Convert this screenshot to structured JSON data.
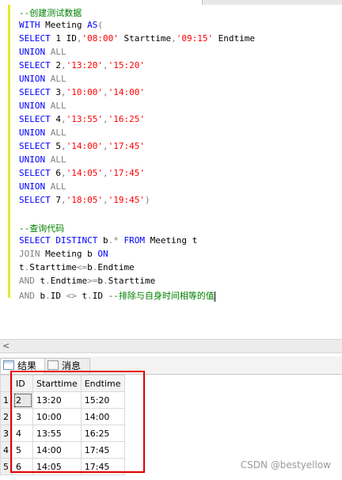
{
  "code_lines": [
    [
      {
        "t": "--创建测试数据",
        "c": "cmt"
      }
    ],
    [
      {
        "t": "WITH ",
        "c": "kw"
      },
      {
        "t": "Meeting ",
        "c": "plain"
      },
      {
        "t": "AS",
        "c": "kw"
      },
      {
        "t": "(",
        "c": "gray"
      }
    ],
    [
      {
        "t": "SELECT ",
        "c": "kw"
      },
      {
        "t": "1 ",
        "c": "plain"
      },
      {
        "t": "ID",
        "c": "plain"
      },
      {
        "t": ",",
        "c": "gray"
      },
      {
        "t": "'08:00'",
        "c": "str"
      },
      {
        "t": " Starttime",
        "c": "plain"
      },
      {
        "t": ",",
        "c": "gray"
      },
      {
        "t": "'09:15'",
        "c": "str"
      },
      {
        "t": " Endtime",
        "c": "plain"
      }
    ],
    [
      {
        "t": "UNION ",
        "c": "kw"
      },
      {
        "t": "ALL",
        "c": "gray"
      }
    ],
    [
      {
        "t": "SELECT ",
        "c": "kw"
      },
      {
        "t": "2",
        "c": "plain"
      },
      {
        "t": ",",
        "c": "gray"
      },
      {
        "t": "'13:20'",
        "c": "str"
      },
      {
        "t": ",",
        "c": "gray"
      },
      {
        "t": "'15:20'",
        "c": "str"
      }
    ],
    [
      {
        "t": "UNION ",
        "c": "kw"
      },
      {
        "t": "ALL",
        "c": "gray"
      }
    ],
    [
      {
        "t": "SELECT ",
        "c": "kw"
      },
      {
        "t": "3",
        "c": "plain"
      },
      {
        "t": ",",
        "c": "gray"
      },
      {
        "t": "'10:00'",
        "c": "str"
      },
      {
        "t": ",",
        "c": "gray"
      },
      {
        "t": "'14:00'",
        "c": "str"
      }
    ],
    [
      {
        "t": "UNION ",
        "c": "kw"
      },
      {
        "t": "ALL",
        "c": "gray"
      }
    ],
    [
      {
        "t": "SELECT ",
        "c": "kw"
      },
      {
        "t": "4",
        "c": "plain"
      },
      {
        "t": ",",
        "c": "gray"
      },
      {
        "t": "'13:55'",
        "c": "str"
      },
      {
        "t": ",",
        "c": "gray"
      },
      {
        "t": "'16:25'",
        "c": "str"
      }
    ],
    [
      {
        "t": "UNION ",
        "c": "kw"
      },
      {
        "t": "ALL",
        "c": "gray"
      }
    ],
    [
      {
        "t": "SELECT ",
        "c": "kw"
      },
      {
        "t": "5",
        "c": "plain"
      },
      {
        "t": ",",
        "c": "gray"
      },
      {
        "t": "'14:00'",
        "c": "str"
      },
      {
        "t": ",",
        "c": "gray"
      },
      {
        "t": "'17:45'",
        "c": "str"
      }
    ],
    [
      {
        "t": "UNION ",
        "c": "kw"
      },
      {
        "t": "ALL",
        "c": "gray"
      }
    ],
    [
      {
        "t": "SELECT ",
        "c": "kw"
      },
      {
        "t": "6",
        "c": "plain"
      },
      {
        "t": ",",
        "c": "gray"
      },
      {
        "t": "'14:05'",
        "c": "str"
      },
      {
        "t": ",",
        "c": "gray"
      },
      {
        "t": "'17:45'",
        "c": "str"
      }
    ],
    [
      {
        "t": "UNION ",
        "c": "kw"
      },
      {
        "t": "ALL",
        "c": "gray"
      }
    ],
    [
      {
        "t": "SELECT ",
        "c": "kw"
      },
      {
        "t": "7",
        "c": "plain"
      },
      {
        "t": ",",
        "c": "gray"
      },
      {
        "t": "'18:05'",
        "c": "str"
      },
      {
        "t": ",",
        "c": "gray"
      },
      {
        "t": "'19:45'",
        "c": "str"
      },
      {
        "t": ")",
        "c": "gray"
      }
    ],
    [],
    [
      {
        "t": "--查询代码",
        "c": "cmt"
      }
    ],
    [
      {
        "t": "SELECT ",
        "c": "kw"
      },
      {
        "t": "DISTINCT ",
        "c": "kw"
      },
      {
        "t": "b",
        "c": "plain"
      },
      {
        "t": ".",
        "c": "gray"
      },
      {
        "t": "* ",
        "c": "gray"
      },
      {
        "t": "FROM ",
        "c": "kw"
      },
      {
        "t": "Meeting ",
        "c": "plain"
      },
      {
        "t": "t",
        "c": "plain"
      }
    ],
    [
      {
        "t": "JOIN ",
        "c": "gray"
      },
      {
        "t": "Meeting ",
        "c": "plain"
      },
      {
        "t": "b ",
        "c": "plain"
      },
      {
        "t": "ON",
        "c": "kw"
      }
    ],
    [
      {
        "t": "t",
        "c": "plain"
      },
      {
        "t": ".",
        "c": "gray"
      },
      {
        "t": "Starttime",
        "c": "plain"
      },
      {
        "t": "<=",
        "c": "gray"
      },
      {
        "t": "b",
        "c": "plain"
      },
      {
        "t": ".",
        "c": "gray"
      },
      {
        "t": "Endtime",
        "c": "plain"
      }
    ],
    [
      {
        "t": "AND ",
        "c": "gray"
      },
      {
        "t": "t",
        "c": "plain"
      },
      {
        "t": ".",
        "c": "gray"
      },
      {
        "t": "Endtime",
        "c": "plain"
      },
      {
        "t": ">=",
        "c": "gray"
      },
      {
        "t": "b",
        "c": "plain"
      },
      {
        "t": ".",
        "c": "gray"
      },
      {
        "t": "Starttime",
        "c": "plain"
      }
    ],
    [
      {
        "t": "AND ",
        "c": "gray"
      },
      {
        "t": "b",
        "c": "plain"
      },
      {
        "t": ".",
        "c": "gray"
      },
      {
        "t": "ID ",
        "c": "plain"
      },
      {
        "t": "<> ",
        "c": "gray"
      },
      {
        "t": "t",
        "c": "plain"
      },
      {
        "t": ".",
        "c": "gray"
      },
      {
        "t": "ID ",
        "c": "plain"
      },
      {
        "t": "--排除与自身时间相等的值",
        "c": "cmt"
      }
    ]
  ],
  "colors": {
    "kw": "#0000ff",
    "str": "#ff0000",
    "cmt": "#008000",
    "gray": "#808080",
    "plain": "#000000"
  },
  "tabs": {
    "results_label": "结果",
    "messages_label": "消息",
    "results_icon": "grid-icon",
    "messages_icon": "message-icon"
  },
  "grid": {
    "columns": [
      "ID",
      "Starttime",
      "Endtime"
    ],
    "rows": [
      {
        "num": "1",
        "cells": [
          "2",
          "13:20",
          "15:20"
        ]
      },
      {
        "num": "2",
        "cells": [
          "3",
          "10:00",
          "14:00"
        ]
      },
      {
        "num": "3",
        "cells": [
          "4",
          "13:55",
          "16:25"
        ]
      },
      {
        "num": "4",
        "cells": [
          "5",
          "14:00",
          "17:45"
        ]
      },
      {
        "num": "5",
        "cells": [
          "6",
          "14:05",
          "17:45"
        ]
      }
    ]
  },
  "scroll_arrow": "<",
  "watermark": "CSDN @bestyellow"
}
